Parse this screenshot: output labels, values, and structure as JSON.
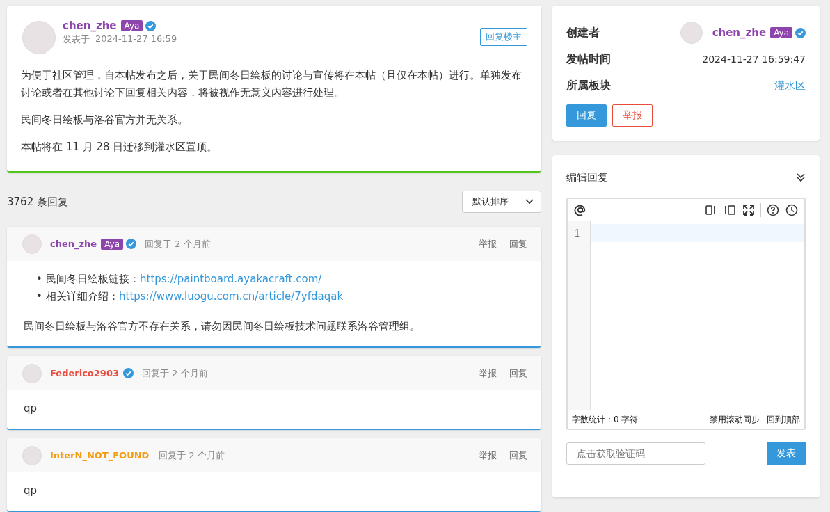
{
  "post": {
    "author": {
      "name": "chen_zhe",
      "color": "#8e44ad",
      "badge": "Aya",
      "verified": true
    },
    "posted_label": "发表于",
    "posted_time": "2024-11-27 16:59",
    "reply_op_button": "回复楼主",
    "paragraphs": [
      "为便于社区管理，自本帖发布之后，关于民间冬日绘板的讨论与宣传将在本帖（且仅在本帖）进行。单独发布讨论或者在其他讨论下回复相关内容，将被视作无意义内容进行处理。",
      "民间冬日绘板与洛谷官方并无关系。",
      "本帖将在 11 月 28 日迁移到灌水区置顶。"
    ]
  },
  "replies_header": {
    "count": "3762 条回复",
    "sort": "默认排序"
  },
  "replies": [
    {
      "author": {
        "name": "chen_zhe",
        "color": "#8e44ad",
        "badge": "Aya",
        "verified": true
      },
      "time": "回复于 2 个月前",
      "actions": [
        "举报",
        "回复"
      ],
      "body": [
        {
          "kind": "list",
          "items": [
            {
              "marker": "•",
              "label": "民间冬日绘板链接：",
              "link": "https://paintboard.ayakacraft.com/"
            },
            {
              "marker": "•",
              "label": "相关详细介绍：",
              "link": "https://www.luogu.com.cn/article/7yfdaqak"
            }
          ]
        },
        {
          "kind": "paragraph",
          "text": "民间冬日绘板与洛谷官方不存在关系，请勿因民间冬日绘板技术问题联系洛谷管理组。"
        }
      ]
    },
    {
      "author": {
        "name": "Federico2903",
        "color": "#e74c3c",
        "verified": true
      },
      "time": "回复于 2 个月前",
      "actions": [
        "举报",
        "回复"
      ],
      "body": [
        {
          "kind": "paragraph",
          "text": "qp"
        }
      ]
    },
    {
      "author": {
        "name": "InterN_NOT_FOUND",
        "color": "#f39c12",
        "verified": false
      },
      "time": "回复于 2 个月前",
      "actions": [
        "举报",
        "回复"
      ],
      "body": [
        {
          "kind": "paragraph",
          "text": "qp"
        }
      ]
    }
  ],
  "sidebar": {
    "info": [
      {
        "kind": "author",
        "label": "创建者",
        "author": {
          "name": "chen_zhe",
          "color": "#8e44ad",
          "badge": "Aya",
          "verified": true
        }
      },
      {
        "kind": "text",
        "label": "发帖时间",
        "value": "2024-11-27 16:59:47"
      },
      {
        "kind": "link",
        "label": "所属板块",
        "value": "灌水区"
      }
    ],
    "buttons": [
      {
        "label": "回复",
        "kind": "primary"
      },
      {
        "label": "举报",
        "kind": "danger"
      }
    ]
  },
  "editor": {
    "title": "编辑回复",
    "line_numbers": [
      "1"
    ],
    "word_count": "字数统计：0 字符",
    "footer_links": [
      "禁用滚动同步",
      "回到顶部"
    ],
    "captcha_placeholder": "点击获取验证码",
    "submit": "发表"
  }
}
